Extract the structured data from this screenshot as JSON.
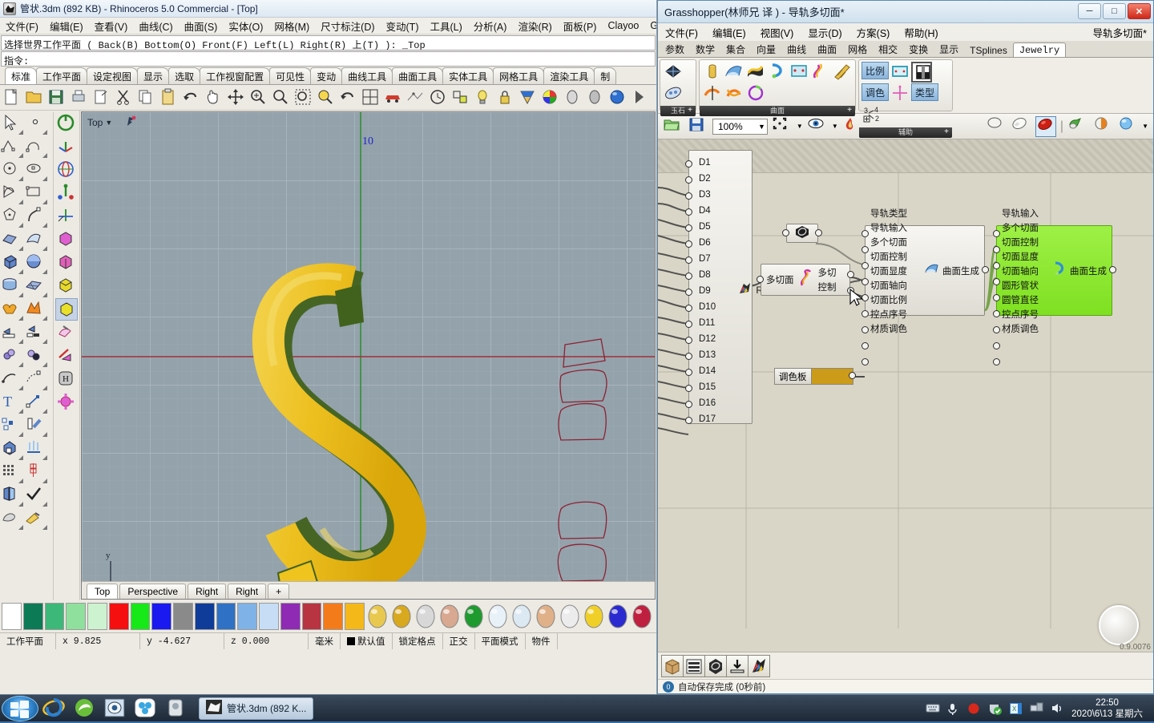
{
  "rhino": {
    "title": "管状.3dm (892 KB) - Rhinoceros 5.0 Commercial - [Top]",
    "menu": [
      "文件(F)",
      "编辑(E)",
      "查看(V)",
      "曲线(C)",
      "曲面(S)",
      "实体(O)",
      "网格(M)",
      "尺寸标注(D)",
      "变动(T)",
      "工具(L)",
      "分析(A)",
      "渲染(R)",
      "面板(P)",
      "Clayoo",
      "Gras"
    ],
    "prompt_line": "选择世界工作平面 ( Back(B)  Bottom(O)  Front(F)  Left(L)  Right(R)  上(T) ): _Top",
    "command_label": "指令:",
    "command_value": "",
    "toolbar_tabs": [
      "标准",
      "工作平面",
      "设定视图",
      "显示",
      "选取",
      "工作视窗配置",
      "可见性",
      "变动",
      "曲线工具",
      "曲面工具",
      "实体工具",
      "网格工具",
      "渲染工具",
      "制"
    ],
    "active_toolbar_tab": "标准",
    "toolbar_icons": [
      "new-file-icon",
      "open-folder-icon",
      "save-icon",
      "print-icon",
      "export-icon",
      "cut-icon",
      "copy-icon",
      "paste-icon",
      "undo-icon",
      "pan-icon",
      "move-icon",
      "zoom-in-icon",
      "zoom-window-icon",
      "zoom-extents-icon",
      "zoom-selected-icon",
      "rotate-view-icon",
      "grid-icon",
      "render-icon",
      "mesh-icon",
      "clock-icon",
      "layout-icon",
      "light-icon",
      "lock-icon",
      "gradient-icon",
      "color-wheel-icon",
      "sphere-gray-icon",
      "sphere-gray2-icon",
      "sphere-blue-icon",
      "next-icon"
    ],
    "left_tools_col": [
      "select-arrow-icon",
      "point-icon",
      "polyline-icon",
      "curve-icon",
      "circle-icon",
      "ellipse-icon",
      "arc-icon",
      "rectangle-icon",
      "polygon-icon",
      "freeform-curve-icon",
      "surface-grid-icon",
      "surface-loft-icon",
      "box-icon",
      "sphere-icon",
      "cylinder-icon",
      "plane-icon",
      "boolean-union-icon",
      "explode-icon",
      "trim-icon",
      "split-icon",
      "blend-icon",
      "offset-icon",
      "fillet-curve-icon",
      "dashed-curve-icon",
      "text-icon",
      "dimension-icon",
      "group-icon",
      "extrude-icon",
      "solid-box-icon",
      "array-icon",
      "grid-array-icon",
      "linear-array-icon",
      "mirror-icon",
      "check-icon",
      "shade-icon",
      "paint-icon"
    ],
    "left_view_col": [
      "power-icon",
      "axis-icon",
      "globe-icon",
      "gumball-icon",
      "move-axis-icon",
      "box-magenta-icon",
      "box-pink-icon",
      "box-yellow-icon",
      "box-yellow-sel-icon",
      "eraser-icon",
      "pink-arrow-icon",
      "hidden-icon",
      "gear-icon"
    ],
    "viewport": {
      "label": "Top",
      "axis_tick": "10",
      "tabs": [
        "Top",
        "Perspective",
        "Right",
        "Right"
      ],
      "active_tab": "Top",
      "add_tab": "+",
      "model_color": "#e8b323",
      "model_back_color": "#41621c",
      "curve_color": "#8c2230"
    },
    "palette_colors": [
      "#ffffff",
      "#0d7a56",
      "#3cb878",
      "#8fe09c",
      "#cdf2cf",
      "#f50f0f",
      "#17e817",
      "#1919f0",
      "#8a8a8a",
      "#0f3c99",
      "#2f71c4",
      "#7fb2e6",
      "#c6ddf5",
      "#8f2ab5",
      "#b83440",
      "#f47b1a",
      "#f5b819"
    ],
    "palette_materials": [
      "gold-gem-icon",
      "gold-ball-icon",
      "silver-ball-icon",
      "copper-ball-icon",
      "green-gem-icon",
      "diamond-icon",
      "diamond2-icon",
      "bronze-pearl-icon",
      "white-pearl-icon",
      "gold-nugget-icon",
      "sapphire-icon",
      "ruby-icon"
    ],
    "status": [
      "工作平面",
      "x 9.825",
      "y -4.627",
      "z 0.000",
      "毫米",
      "默认值",
      "锁定格点",
      "正交",
      "平面模式",
      "物件"
    ],
    "status_layer_swatch": "#000000"
  },
  "grasshopper": {
    "title": "Grasshopper(林师兄 译 ) - 导轨多切面*",
    "doc_name": "导轨多切面*",
    "window_buttons": [
      "minimize",
      "maximize",
      "close"
    ],
    "menu": [
      "文件(F)",
      "编辑(E)",
      "视图(V)",
      "显示(D)",
      "方案(S)",
      "帮助(H)"
    ],
    "tabs": [
      "参数",
      "数学",
      "集合",
      "向量",
      "曲线",
      "曲面",
      "网格",
      "相交",
      "变换",
      "显示",
      "TSplines",
      "Jewelry"
    ],
    "active_tab": "Jewelry",
    "ribbon_groups": [
      {
        "caption": "玉石",
        "icons": [
          "gem-cut-icon",
          "gem-oval-icon"
        ]
      },
      {
        "caption": "曲面",
        "icons": [
          "cylinder-gold-icon",
          "blue-fold-icon",
          "wave-surf-icon",
          "blue-arc-icon",
          "square-node-icon",
          "twist-pink-icon",
          "twisted-bar-icon",
          "orange-flow-icon",
          "orange-twist-icon",
          "purple-ring-icon"
        ]
      },
      {
        "caption": "辅助",
        "icons": [
          "比例",
          "rect-cyan-icon",
          "gradient-bw-icon",
          "调色",
          "cross-pink-icon",
          "类型",
          "number-tree-icon"
        ]
      }
    ],
    "toolbar2": {
      "open_icon": "open-folder-icon",
      "save_icon": "save-disk-icon",
      "zoom_value": "100%",
      "icons": [
        "fit-view-icon",
        "preview-eye-icon",
        "flame-icon",
        "bake-dark-icon",
        "bake-light-icon",
        "bake-red-icon",
        "preview-green-icon",
        "preview-orange-icon",
        "preview-blue-icon"
      ]
    },
    "nodes": {
      "param_list": {
        "items": [
          "D1",
          "D2",
          "D3",
          "D4",
          "D5",
          "D6",
          "D7",
          "D8",
          "D9",
          "D10",
          "D11",
          "D12",
          "D13",
          "D14",
          "D15",
          "D16",
          "D17"
        ],
        "output_label": "R"
      },
      "hex_node": {
        "icon": "gem-hex-icon"
      },
      "multisection": {
        "label": "多切面",
        "out1": "多切",
        "out2": "控制",
        "icon": "twist-pink-icon"
      },
      "palette_node": {
        "label": "调色板",
        "color": "#cb9b19"
      },
      "surface_node": {
        "inputs": [
          "导轨类型",
          "导轨输入",
          "多个切面",
          "切面控制",
          "切面显度",
          "切面轴向",
          "切面比例",
          "控点序号",
          "材质调色"
        ],
        "output": "曲面生成",
        "icon": "blue-fold-icon"
      },
      "green_node": {
        "inputs": [
          "导轨输入",
          "多个切面",
          "切面控制",
          "切面显度",
          "切面轴向",
          "圆形管状",
          "圆管直径",
          "控点序号",
          "材质调色"
        ],
        "output": "曲面生成",
        "icon": "blue-arc-icon",
        "color": "#8ae633"
      }
    },
    "bottom_icons": [
      "box-brown-icon",
      "list-icon",
      "gem-hex-icon",
      "bake-download-icon",
      "rainbow-bird-icon"
    ],
    "status_text": "自动保存完成 (0秒前)",
    "status_badge": "0",
    "canvas_zoom_readout": "0.9.0076"
  },
  "taskbar": {
    "start": "start-orb",
    "quick_icons": [
      "ie-icon",
      "edge-green-icon",
      "photo-icon",
      "sogou-icon",
      "app-icon"
    ],
    "active_task": {
      "label": "管状.3dm (892 K...",
      "icon": "rhino-icon"
    },
    "tray_icons": [
      "keyboard-icon",
      "mic-icon",
      "record-icon",
      "shield-green-icon",
      "excel-icon",
      "network-icon",
      "volume-icon"
    ],
    "time": "22:50",
    "date": "2020\\6\\13 星期六"
  }
}
